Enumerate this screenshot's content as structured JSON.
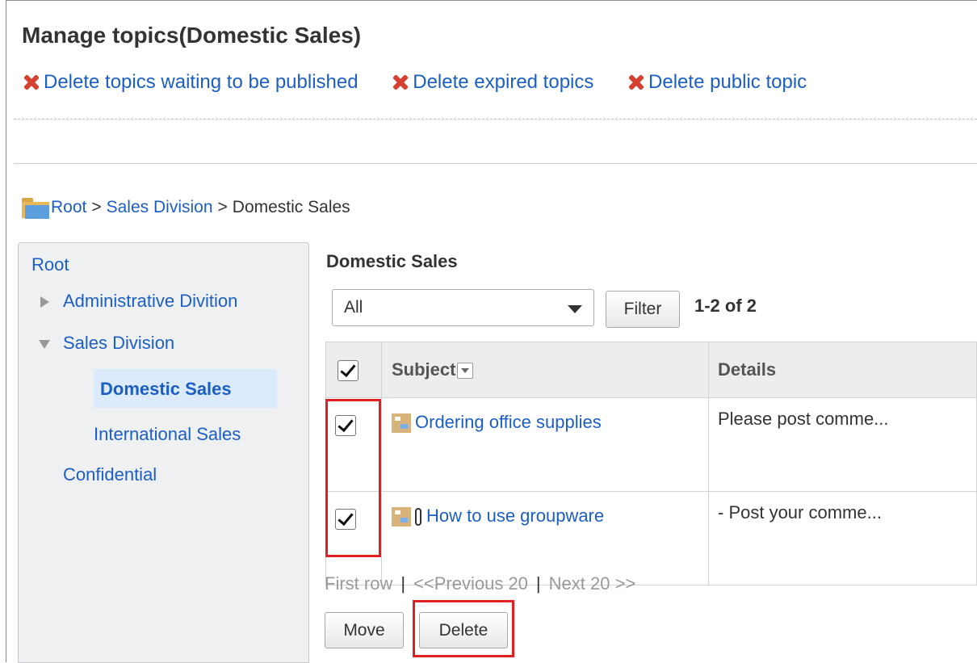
{
  "page": {
    "title": "Manage topics(Domestic Sales)"
  },
  "actions": [
    {
      "label": "Delete topics waiting to be published",
      "icon": "delete-x-icon"
    },
    {
      "label": "Delete expired topics",
      "icon": "delete-x-icon"
    },
    {
      "label": "Delete public topic",
      "icon": "delete-x-icon"
    }
  ],
  "breadcrumb": {
    "icon": "folder-icon",
    "items": [
      "Root",
      "Sales Division",
      "Domestic Sales"
    ],
    "separator": ">"
  },
  "sidebar": {
    "root": "Root",
    "items": [
      {
        "label": "Administrative Divition",
        "expander": "collapsed"
      },
      {
        "label": "Sales Division",
        "expander": "expanded"
      },
      {
        "label": "Domestic Sales",
        "selected": true
      },
      {
        "label": "International Sales"
      },
      {
        "label": "Confidential"
      }
    ]
  },
  "main": {
    "section_title": "Domestic Sales",
    "filter_select": "All",
    "filter_button": "Filter",
    "count": "1-2 of 2",
    "table": {
      "headers": [
        "",
        "Subject",
        "Details"
      ],
      "rows": [
        {
          "checked": true,
          "subject": "Ordering office supplies",
          "details": "Please post comme...",
          "has_attachment": false
        },
        {
          "checked": true,
          "subject": "How to use groupware",
          "details": "- Post your comme...",
          "has_attachment": true
        }
      ]
    },
    "pager": {
      "first": "First row",
      "separator": "|",
      "previous": "<<Previous 20",
      "next": "Next 20 >>"
    },
    "move_button": "Move",
    "delete_button": "Delete"
  },
  "colors": {
    "link": "#1c5fc4",
    "delete_icon": "#d64031",
    "highlight_box": "#e02020",
    "sidebar_bg": "#eef0f2",
    "selected_bg": "#dcebfb"
  }
}
